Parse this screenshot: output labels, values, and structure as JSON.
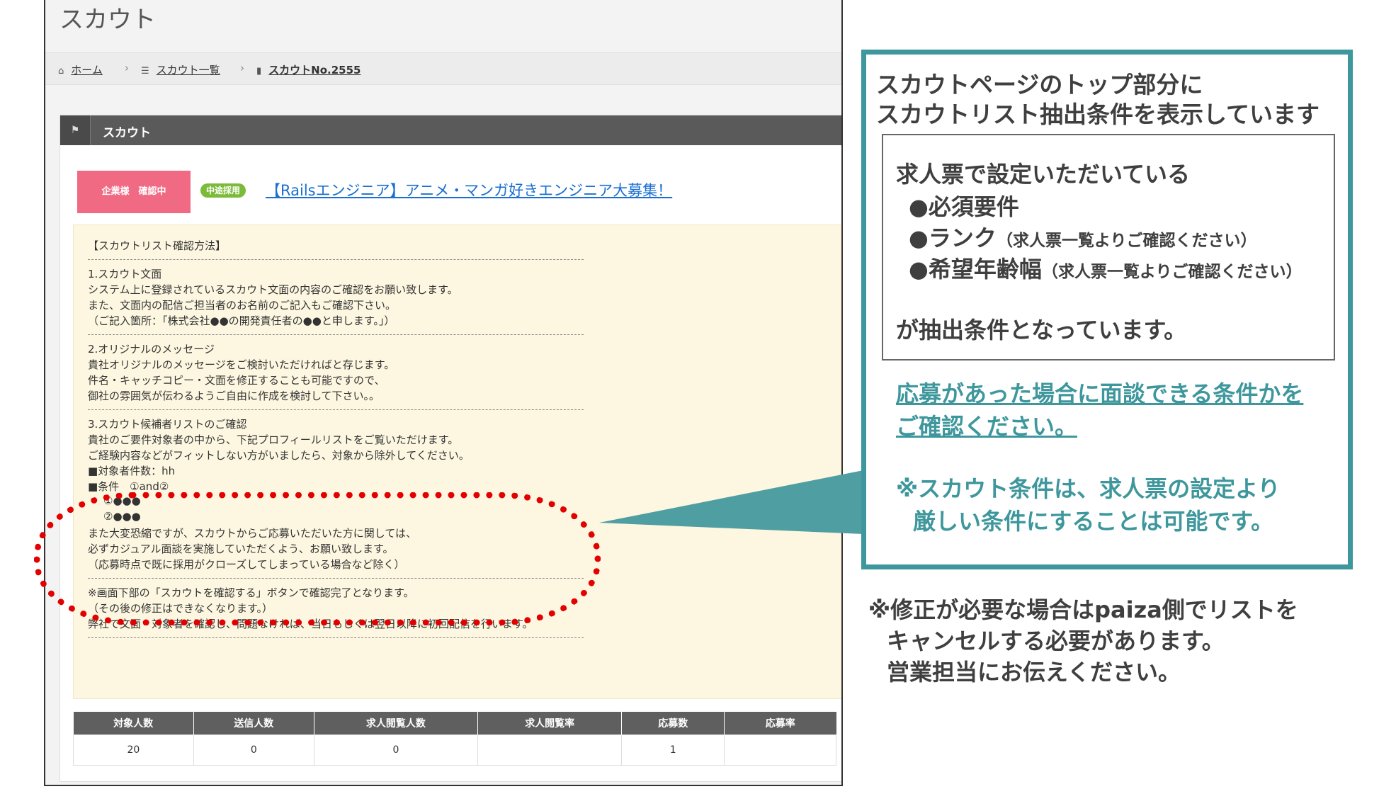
{
  "page": {
    "title": "スカウト",
    "breadcrumbs": [
      {
        "icon": "home-icon",
        "label": "ホーム"
      },
      {
        "icon": "list-icon",
        "label": "スカウト一覧"
      },
      {
        "icon": "file-icon",
        "label": "スカウトNo.2555"
      }
    ],
    "breadcrumb_separator": "›"
  },
  "panel": {
    "title": "スカウト",
    "status_badge": "企業様　確認中",
    "hire_tag": "中途採用",
    "job_link": "【Railsエンジニア】アニメ・マンガ好きエンジニア大募集！"
  },
  "notice": {
    "lines": [
      "【スカウトリスト確認方法】",
      "1.スカウト文面",
      "システム上に登録されているスカウト文面の内容のご確認をお願い致します。",
      "また、文面内の配信ご担当者のお名前のご記入もご確認下さい。",
      "（ご記入箇所：「株式会社●●の開発責任者の●●と申します。」）",
      "2.オリジナルのメッセージ",
      "貴社オリジナルのメッセージをご検討いただければと存じます。",
      "件名・キャッチコピー・文面を修正することも可能ですので、",
      "御社の雰囲気が伝わるようご自由に作成を検討して下さい。。",
      "3.スカウト候補者リストのご確認",
      "貴社のご要件対象者の中から、下記プロフィールリストをご覧いただけます。",
      "ご経験内容などがフィットしない方がいましたら、対象から除外してください。",
      "■対象者件数：hh",
      "■条件　①and②",
      "①●●●",
      "②●●●",
      "また大変恐縮ですが、スカウトからご応募いただいた方に関しては、",
      "必ずカジュアル面談を実施していただくよう、お願い致します。",
      "（応募時点で既に採用がクローズしてしまっている場合など除く）",
      "※画面下部の「スカウトを確認する」ボタンで確認完了となります。",
      "（その後の修正はできなくなります。）",
      "弊社で文面・対象者を確認し、問題なければ、当日もしくは翌日以降に初回配信を行います。"
    ]
  },
  "stats": {
    "headers": [
      "対象人数",
      "送信人数",
      "求人閲覧人数",
      "求人閲覧率",
      "応募数",
      "応募率"
    ],
    "values": [
      "20",
      "0",
      "0",
      "",
      "1",
      ""
    ]
  },
  "callout": {
    "heading1": "スカウトページのトップ部分に",
    "heading2": "スカウトリスト抽出条件を表示しています",
    "box_line1": "求人票で設定いただいている",
    "item1": "●必須要件",
    "item2": "●ランク",
    "item2_note": "（求人票一覧よりご確認ください）",
    "item3": "●希望年齢幅",
    "item3_note": "（求人票一覧よりご確認ください）",
    "box_last": "が抽出条件となっています。",
    "link1": "応募があった場合に面談できる条件かを",
    "link2": "ご確認ください。",
    "caution1": "※スカウト条件は、求人票の設定より",
    "caution2": "厳しい条件にすることは可能です。"
  },
  "footnote": [
    "※修正が必要な場合はpaiza側でリストを",
    "キャンセルする必要があります。",
    "営業担当にお伝えください。"
  ],
  "colors": {
    "accent": "#3e979c",
    "highlight": "#e20000",
    "badge": "#f06a84",
    "tag": "#7cbb3a",
    "link": "#1a6fd1"
  }
}
